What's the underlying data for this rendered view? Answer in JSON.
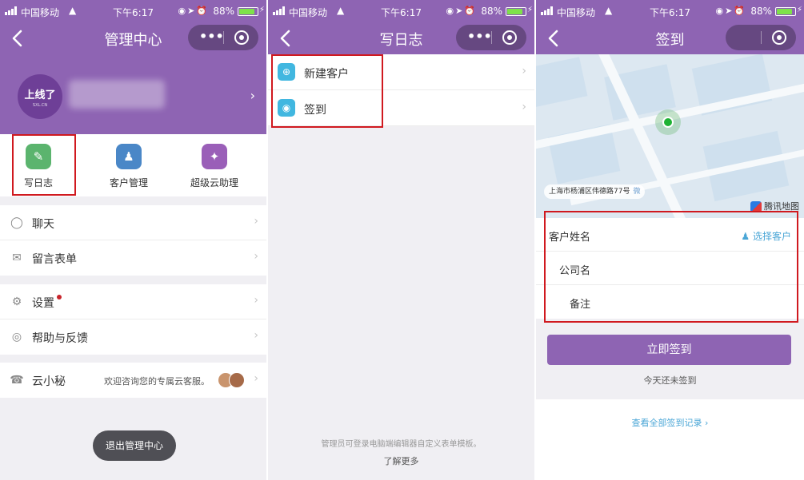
{
  "status_bar": {
    "carrier": "中国移动",
    "time": "下午6:17",
    "battery": "88%",
    "battery_level": 0.88
  },
  "capsule": {
    "more": "•••"
  },
  "colors": {
    "brand": "#8e64b3",
    "highlight": "#d0191f",
    "link": "#4aa6d6",
    "pin": "#1fb234"
  },
  "panel1": {
    "title": "管理中心",
    "avatar": {
      "line1": "上线了",
      "line2": "SXL.CN"
    },
    "grid": [
      {
        "label": "写日志",
        "icon": "pencil-icon",
        "color": "#5bb46e"
      },
      {
        "label": "客户管理",
        "icon": "customers-icon",
        "color": "#4a87c7"
      },
      {
        "label": "超级云助理",
        "icon": "assistant-icon",
        "color": "#9a5fb8"
      }
    ],
    "section1": [
      {
        "label": "聊天",
        "icon": "chat-icon"
      },
      {
        "label": "留言表单",
        "icon": "mail-icon"
      }
    ],
    "section2": [
      {
        "label": "设置",
        "icon": "gear-icon"
      },
      {
        "label": "帮助与反馈",
        "icon": "help-icon"
      }
    ],
    "service": {
      "label": "云小秘",
      "icon": "headset-icon",
      "hint": "欢迎咨询您的专属云客服。"
    },
    "exit_label": "退出管理中心"
  },
  "panel2": {
    "title": "写日志",
    "items": [
      {
        "label": "新建客户",
        "icon": "plus-circle-icon"
      },
      {
        "label": "签到",
        "icon": "location-pin-icon"
      }
    ],
    "footer_note": "管理员可登录电脑端编辑器自定义表单模板。",
    "learn_more": "了解更多"
  },
  "panel3": {
    "title": "签到",
    "map": {
      "address": "上海市杨浦区伟德路77号",
      "address_tag": "微",
      "provider": "腾讯地图"
    },
    "form": {
      "customer_label": "客户姓名",
      "select_customer": "选择客户",
      "company_label": "公司名",
      "note_label": "备注"
    },
    "checkin_button": "立即签到",
    "status_note": "今天还未签到",
    "view_records": "查看全部签到记录"
  }
}
